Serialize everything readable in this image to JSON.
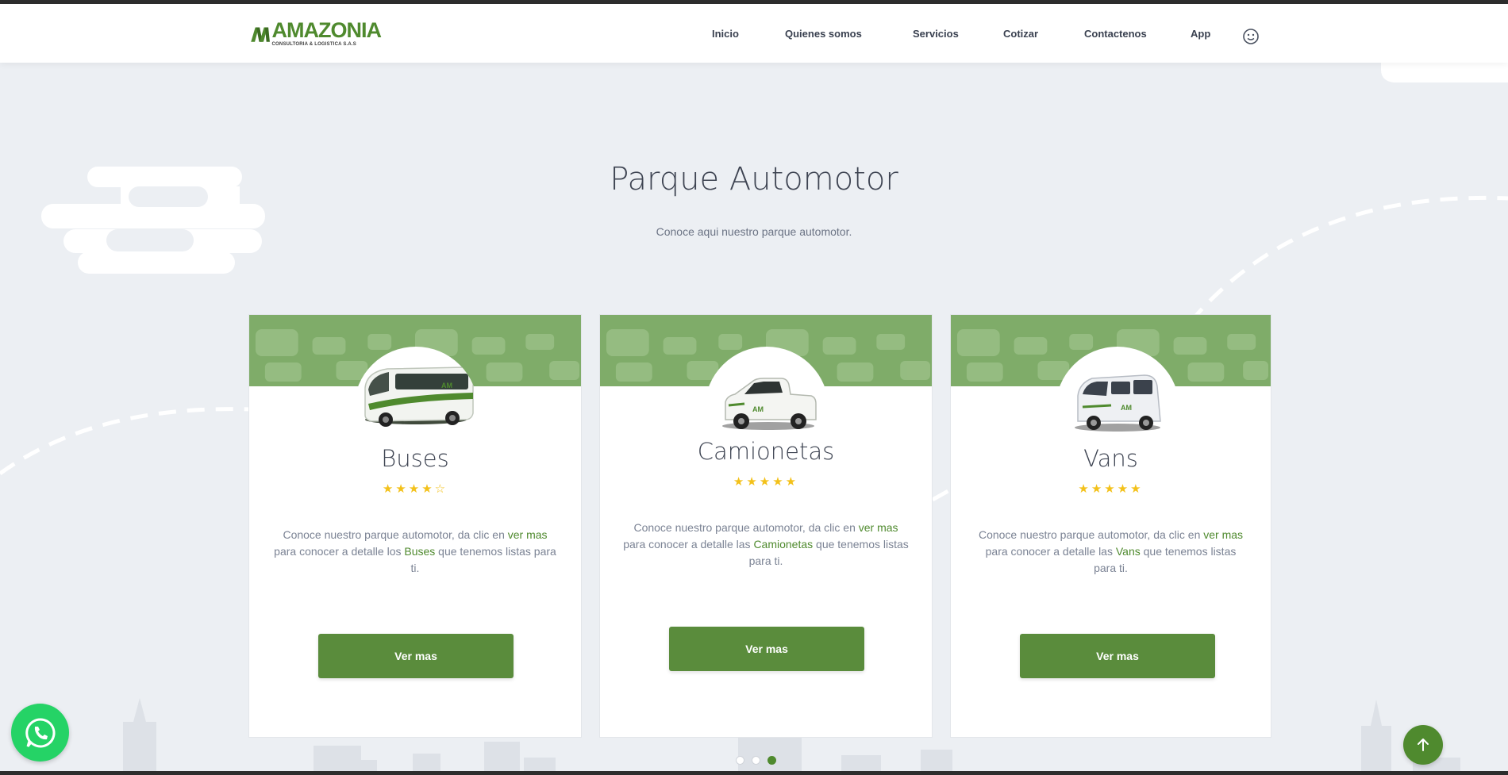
{
  "brand": {
    "name": "AMAZONIA",
    "tagline": "CONSULTORIA & LOGISTICA S.A.S",
    "accent_color": "#4f8a2e"
  },
  "nav": {
    "items": [
      "Inicio",
      "Quienes somos",
      "Servicios",
      "Cotizar",
      "Contactenos",
      "App"
    ],
    "extra_icon": "smiley-icon"
  },
  "section": {
    "title": "Parque Automotor",
    "subtitle": "Conoce aqui nuestro parque automotor."
  },
  "cards": [
    {
      "title": "Buses",
      "rating": 4,
      "max_rating": 5,
      "stars": "★★★★☆",
      "text_a": "Conoce nuestro parque automotor, da clic en ",
      "link": "ver mas",
      "text_b": " para conocer a detalle los ",
      "vehicle": "Buses",
      "text_c": " que tenemos listas para ti.",
      "button": "Ver mas",
      "image_icon": "bus-icon"
    },
    {
      "title": "Camionetas",
      "rating": 5,
      "max_rating": 5,
      "stars": "★★★★★",
      "text_a": "Conoce nuestro parque automotor, da clic en ",
      "link": "ver mas",
      "text_b": " para conocer a detalle las ",
      "vehicle": "Camionetas",
      "text_c": " que tenemos listas para ti.",
      "button": "Ver mas",
      "image_icon": "pickup-truck-icon"
    },
    {
      "title": "Vans",
      "rating": 5,
      "max_rating": 5,
      "stars": "★★★★★",
      "text_a": "Conoce nuestro parque automotor, da clic en ",
      "link": "ver mas",
      "text_b": " para conocer a detalle las ",
      "vehicle": "Vans",
      "text_c": " que tenemos listas para ti.",
      "button": "Ver mas",
      "image_icon": "van-icon"
    }
  ],
  "carousel": {
    "total": 3,
    "active": 3
  },
  "floating": {
    "whatsapp_icon": "whatsapp-icon",
    "scroll_top_icon": "arrow-up-icon"
  }
}
